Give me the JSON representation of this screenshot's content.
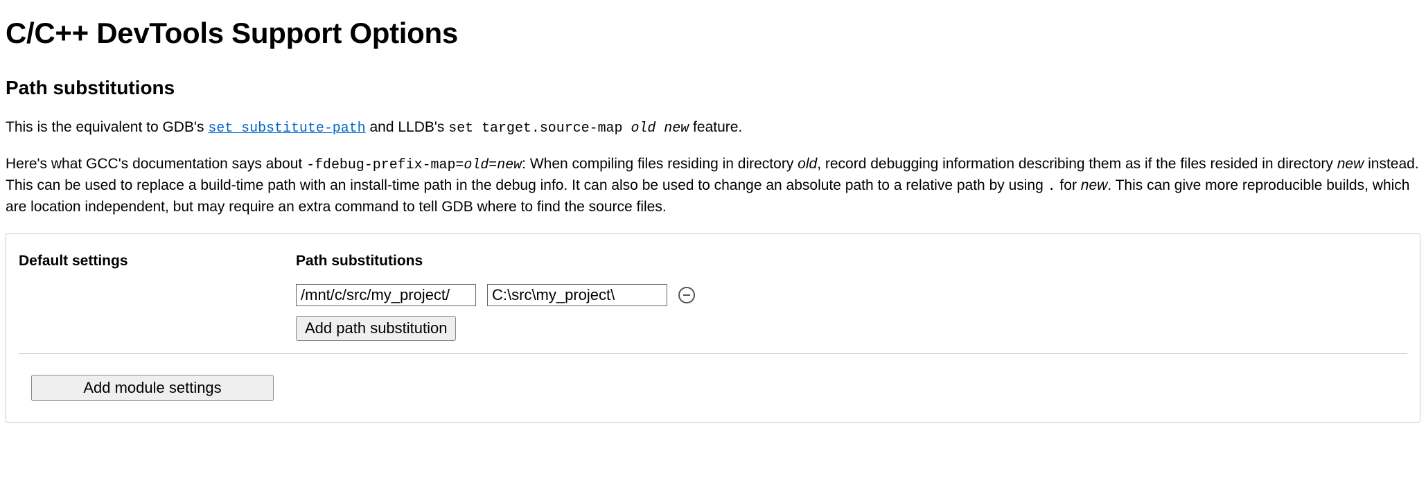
{
  "title": "C/C++ DevTools Support Options",
  "section_heading": "Path substitutions",
  "intro": {
    "text1": "This is the equivalent to GDB's ",
    "link_text": "set substitute-path",
    "text2": " and LLDB's ",
    "code_text": "set target.source-map ",
    "code_italic": "old new",
    "text3": " feature."
  },
  "doc": {
    "t1": "Here's what GCC's documentation says about ",
    "code_text": "-fdebug-prefix-map=",
    "code_italic": "old=new",
    "t2": ": When compiling files residing in directory ",
    "old_em": "old",
    "t3": ", record debugging information describing them as if the files resided in directory ",
    "new_em": "new",
    "t4": " instead. This can be used to replace a build-time path with an install-time path in the debug info. It can also be used to change an absolute path to a relative path by using ",
    "dot_code": ".",
    "t5": " for ",
    "new_em2": "new",
    "t6": ". This can give more reproducible builds, which are location independent, but may require an extra command to tell GDB where to find the source files."
  },
  "panel": {
    "default_settings_label": "Default settings",
    "path_subs_label": "Path substitutions",
    "rows": [
      {
        "from": "/mnt/c/src/my_project/",
        "to": "C:\\src\\my_project\\"
      }
    ],
    "add_path_btn": "Add path substitution",
    "add_module_btn": "Add module settings"
  }
}
